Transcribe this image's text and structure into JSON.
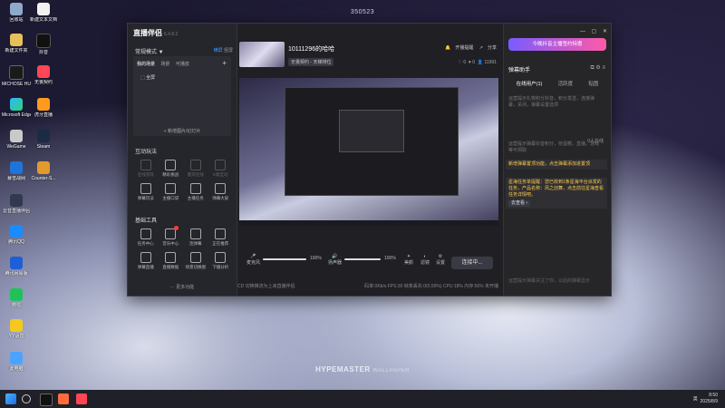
{
  "desktop": {
    "top_label": "350523",
    "bottom_brand_main": "HYPEMASTER",
    "bottom_brand_sub": "WALLPAPER",
    "icons": [
      {
        "label": "回收站"
      },
      {
        "label": "新建文本文档"
      },
      {
        "label": "新建文件夹"
      },
      {
        "label": "抖音"
      },
      {
        "label": "MICHOSE HUB"
      },
      {
        "label": "无畏契约"
      },
      {
        "label": "Microsoft Edge"
      },
      {
        "label": "虎牙直播"
      },
      {
        "label": "WeGame"
      },
      {
        "label": "Steam"
      },
      {
        "label": "暴雪战网"
      },
      {
        "label": "Counter-S..."
      },
      {
        "label": "云音直播伴侣"
      },
      {
        "label": "腾讯QQ"
      },
      {
        "label": "腾讯网易版"
      },
      {
        "label": "微信"
      },
      {
        "label": "YY语音"
      },
      {
        "label": "此电脑"
      }
    ]
  },
  "app": {
    "logo": "直播伴侣",
    "version": "6.4.8.2",
    "mode_label": "常规模式 ▼",
    "mode_options": [
      "横屏",
      "竖屏"
    ],
    "scene_tabs": [
      "我的场景",
      "场景",
      "可播放"
    ],
    "scene_item": "全屏",
    "add_picture": "+ 新增图片/幻灯片",
    "interactive_title": "互动玩法",
    "interactive_tools": [
      "连线游戏",
      "精彩挑战",
      "嘉宾连线",
      "K歌互动",
      "弹幕玩法",
      "主播口袋",
      "主播任务",
      "弹幕大屏"
    ],
    "basic_title": "基础工具",
    "basic_tools": [
      "任务中心",
      "音乐中心",
      "连弹幕",
      "正在推荐",
      "弹幕直播",
      "直播数据",
      "场景切换图",
      "下播分析"
    ],
    "more_features": "⋯ 更多功能"
  },
  "center": {
    "room_title": "10111296的哈哈",
    "room_tag": "无畏契约 - 天梯排位",
    "actions": [
      "开播提醒",
      "分享"
    ],
    "stats": {
      "likes": "0",
      "hearts": "0",
      "viewers": "11991"
    },
    "controls": {
      "mic_label": "麦克风",
      "mic_volume": "100%",
      "speaker_label": "扬声器",
      "speaker_volume": "100%",
      "beauty": "美颜",
      "effects": "滤镜",
      "settings": "设置",
      "go_live": "连接中..."
    },
    "status_left": "CD 切换推流为上来直播伴侣",
    "status_right": "码率:0Kb/s  FPS:30  帧率丢失:0(0.00%)  CPU:18%  内存:56%  未开播"
  },
  "right_panel": {
    "window_controls": [
      "—",
      "▢",
      "✕"
    ],
    "promo": "今晚抖音主播签约特惠",
    "assistant_title": "弹幕助手",
    "tabs": [
      "在线用户(1)",
      "活跃度",
      "贴图"
    ],
    "messages": [
      "运营提示礼物积分抖音，积分发送，连接弹幕，关闭，弹幕设置选项",
      "运营提示弹幕抖音积分，抢蛋糕，直播，游戏等可领取"
    ],
    "count_chip": "0人在线",
    "highlight_text": "新增弹幕置顶功能，点击弹幕添加进置顶",
    "task_text": "星海任务单提醒：您已收到1条星海平台派发的任务，产品名称：风之创舞，点击前往星海查看任务详情吧。",
    "goto_button": "去查看 ›",
    "input_placeholder": "运营提示弹幕关注了你，以后的弹幕显示"
  },
  "taskbar": {
    "time": "8:50",
    "date": "2025/8/9",
    "ime": "英"
  }
}
